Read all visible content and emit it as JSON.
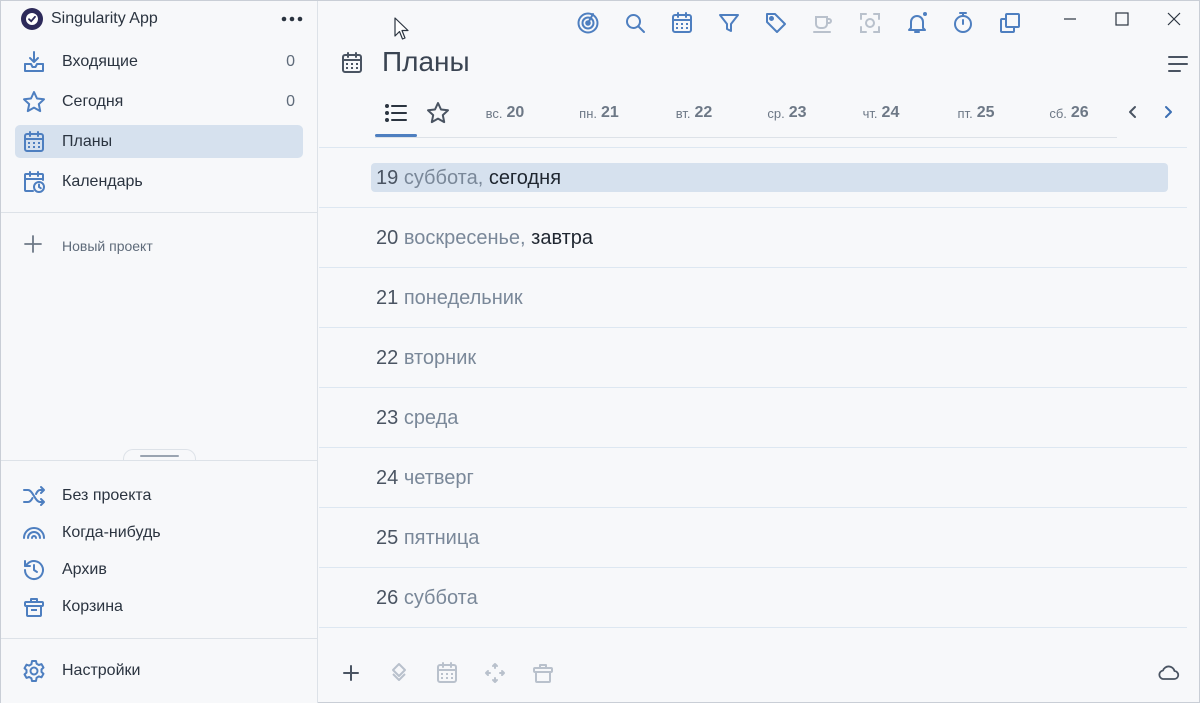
{
  "app": {
    "title": "Singularity App"
  },
  "sidebar": {
    "items": [
      {
        "label": "Входящие",
        "count": "0",
        "icon": "inbox-icon"
      },
      {
        "label": "Сегодня",
        "count": "0",
        "icon": "star-icon"
      },
      {
        "label": "Планы",
        "icon": "calendar-icon",
        "active": true
      },
      {
        "label": "Календарь",
        "icon": "calendar-clock-icon"
      }
    ],
    "new_project": "Новый проект",
    "bottom_items": [
      {
        "label": "Без проекта",
        "icon": "shuffle-icon"
      },
      {
        "label": "Когда-нибудь",
        "icon": "rainbow-icon"
      },
      {
        "label": "Архив",
        "icon": "history-icon"
      },
      {
        "label": "Корзина",
        "icon": "trash-icon"
      }
    ],
    "settings": "Настройки"
  },
  "main": {
    "title": "Планы",
    "tabs": [
      {
        "dow": "вс.",
        "day": "20"
      },
      {
        "dow": "пн.",
        "day": "21"
      },
      {
        "dow": "вт.",
        "day": "22"
      },
      {
        "dow": "ср.",
        "day": "23"
      },
      {
        "dow": "чт.",
        "day": "24"
      },
      {
        "dow": "пт.",
        "day": "25"
      },
      {
        "dow": "сб.",
        "day": "26"
      }
    ],
    "days": [
      {
        "num": "19",
        "dow": "суббота,",
        "rel": "сегодня",
        "today": true
      },
      {
        "num": "20",
        "dow": "воскресенье,",
        "rel": "завтра"
      },
      {
        "num": "21",
        "dow": "понедельник",
        "rel": ""
      },
      {
        "num": "22",
        "dow": "вторник",
        "rel": ""
      },
      {
        "num": "23",
        "dow": "среда",
        "rel": ""
      },
      {
        "num": "24",
        "dow": "четверг",
        "rel": ""
      },
      {
        "num": "25",
        "dow": "пятница",
        "rel": ""
      },
      {
        "num": "26",
        "dow": "суббота",
        "rel": ""
      }
    ]
  },
  "colors": {
    "accent": "#4e7fc0",
    "active_bg": "#d6e1ee",
    "notification_dot": "#4e7fc0"
  }
}
